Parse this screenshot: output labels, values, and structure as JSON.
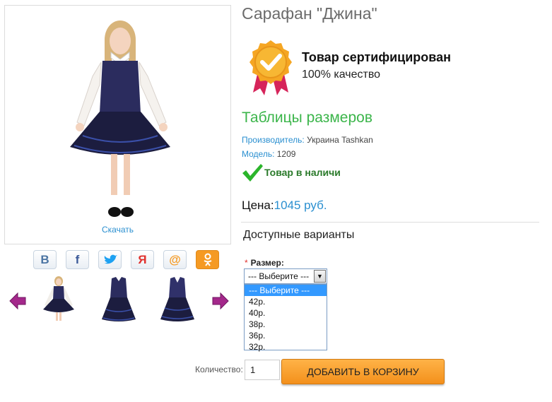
{
  "product": {
    "title": "Сарафан \"Джина\"",
    "download_label": "Скачать"
  },
  "certificate": {
    "title": "Товар сертифицирован",
    "subtitle": "100% качество",
    "badge_icon": "certified-badge-icon",
    "badge_color": "#f5a623",
    "ribbon_color": "#d6245a"
  },
  "size_table_link": "Таблицы размеров",
  "specs": {
    "manufacturer_label": "Производитель:",
    "manufacturer_value": "Украина Tashkan",
    "model_label": "Модель:",
    "model_value": "1209"
  },
  "stock": {
    "text": "Товар в наличи",
    "icon": "checkmark-icon"
  },
  "price": {
    "label": "Цена:",
    "value": "1045 руб."
  },
  "variants": {
    "title": "Доступные варианты",
    "size_required_mark": "*",
    "size_label": "Размер:",
    "selected": "--- Выберите ---",
    "options": [
      "--- Выберите ---",
      "42р.",
      "40р.",
      "38р.",
      "36р.",
      "32р."
    ]
  },
  "cart": {
    "quantity_label": "Количество:",
    "quantity_value": "1",
    "button_label": "ДОБАВИТЬ В КОРЗИНУ"
  },
  "social": [
    {
      "icon": "vk-icon",
      "glyph": "B",
      "color": "#4c75a3"
    },
    {
      "icon": "facebook-icon",
      "glyph": "f",
      "color": "#3b5998"
    },
    {
      "icon": "twitter-icon",
      "glyph": "",
      "color": "#1da1f2"
    },
    {
      "icon": "yandex-icon",
      "glyph": "Я",
      "color": "#e0312d"
    },
    {
      "icon": "mail-icon",
      "glyph": "@",
      "color": "#f59a23"
    },
    {
      "icon": "odnoklassniki-icon",
      "glyph": "",
      "color": "#f59a23"
    }
  ],
  "colors": {
    "accent_blue": "#2a8fd0",
    "accent_green": "#3bb54a",
    "button_orange": "#f7a030",
    "arrow_purple": "#a4288b",
    "dress_navy": "#20214a"
  }
}
